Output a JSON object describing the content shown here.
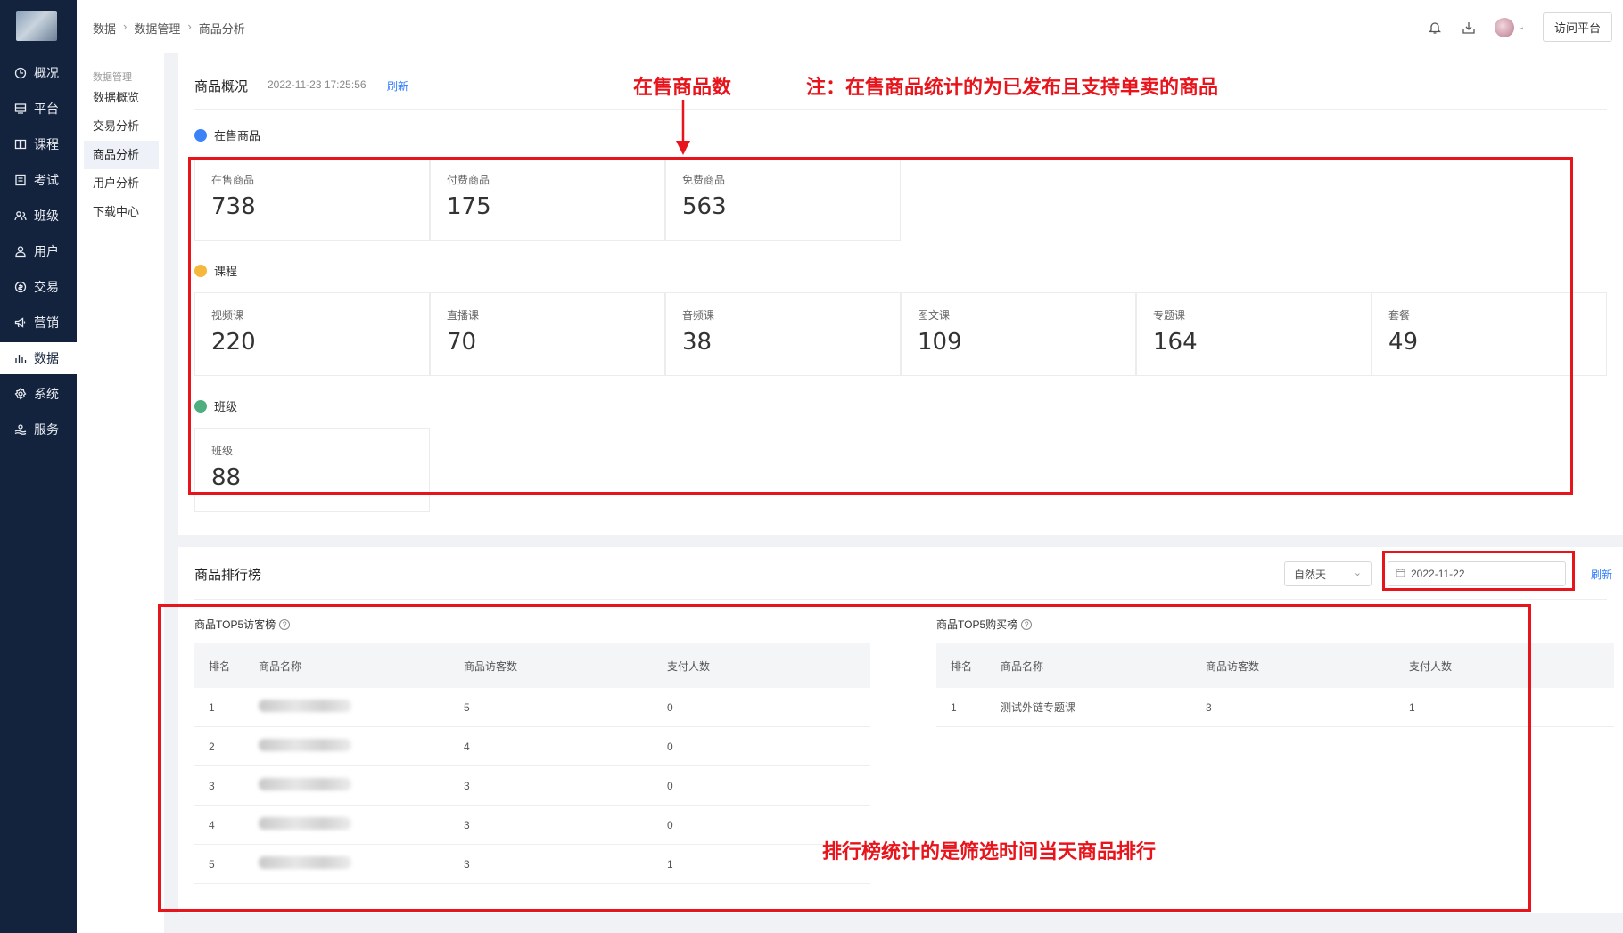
{
  "nav": {
    "items": [
      {
        "label": "概况",
        "icon": "clock-icon"
      },
      {
        "label": "平台",
        "icon": "platform-icon"
      },
      {
        "label": "课程",
        "icon": "book-icon"
      },
      {
        "label": "考试",
        "icon": "exam-icon"
      },
      {
        "label": "班级",
        "icon": "class-icon"
      },
      {
        "label": "用户",
        "icon": "user-icon"
      },
      {
        "label": "交易",
        "icon": "trade-icon"
      },
      {
        "label": "营销",
        "icon": "megaphone-icon"
      },
      {
        "label": "数据",
        "icon": "bar-chart-icon"
      },
      {
        "label": "系统",
        "icon": "gear-icon"
      },
      {
        "label": "服务",
        "icon": "service-icon"
      }
    ]
  },
  "subnav": {
    "group_title": "数据管理",
    "items": [
      "数据概览",
      "交易分析",
      "商品分析",
      "用户分析",
      "下载中心"
    ]
  },
  "breadcrumb": [
    "数据",
    "数据管理",
    "商品分析"
  ],
  "header": {
    "visit_label": "访问平台"
  },
  "overview": {
    "title": "商品概况",
    "timestamp": "2022-11-23 17:25:56",
    "refresh": "刷新",
    "sections": [
      {
        "title": "在售商品",
        "color": "#3b82f6",
        "cards": [
          {
            "label": "在售商品",
            "value": "738"
          },
          {
            "label": "付费商品",
            "value": "175"
          },
          {
            "label": "免费商品",
            "value": "563"
          }
        ]
      },
      {
        "title": "课程",
        "color": "#f5b83b",
        "cards": [
          {
            "label": "视频课",
            "value": "220"
          },
          {
            "label": "直播课",
            "value": "70"
          },
          {
            "label": "音频课",
            "value": "38"
          },
          {
            "label": "图文课",
            "value": "109"
          },
          {
            "label": "专题课",
            "value": "164"
          },
          {
            "label": "套餐",
            "value": "49"
          }
        ]
      },
      {
        "title": "班级",
        "color": "#4caf7d",
        "cards": [
          {
            "label": "班级",
            "value": "88"
          }
        ]
      }
    ]
  },
  "ranking": {
    "title": "商品排行榜",
    "period": "自然天",
    "date": "2022-11-22",
    "refresh": "刷新",
    "visitors": {
      "title": "商品TOP5访客榜",
      "columns": [
        "排名",
        "商品名称",
        "商品访客数",
        "支付人数"
      ],
      "rows": [
        {
          "rank": "1",
          "visitors": "5",
          "payers": "0"
        },
        {
          "rank": "2",
          "visitors": "4",
          "payers": "0"
        },
        {
          "rank": "3",
          "visitors": "3",
          "payers": "0"
        },
        {
          "rank": "4",
          "visitors": "3",
          "payers": "0"
        },
        {
          "rank": "5",
          "visitors": "3",
          "payers": "1"
        }
      ]
    },
    "purchases": {
      "title": "商品TOP5购买榜",
      "columns": [
        "排名",
        "商品名称",
        "商品访客数",
        "支付人数"
      ],
      "rows": [
        {
          "rank": "1",
          "name": "测试外链专题课",
          "visitors": "3",
          "payers": "1"
        }
      ]
    }
  },
  "annotations": {
    "on_sale_count": "在售商品数",
    "note": "注：在售商品统计的为已发布且支持单卖的商品",
    "ranking_note": "排行榜统计的是筛选时间当天商品排行",
    "color": "#e8141c"
  }
}
